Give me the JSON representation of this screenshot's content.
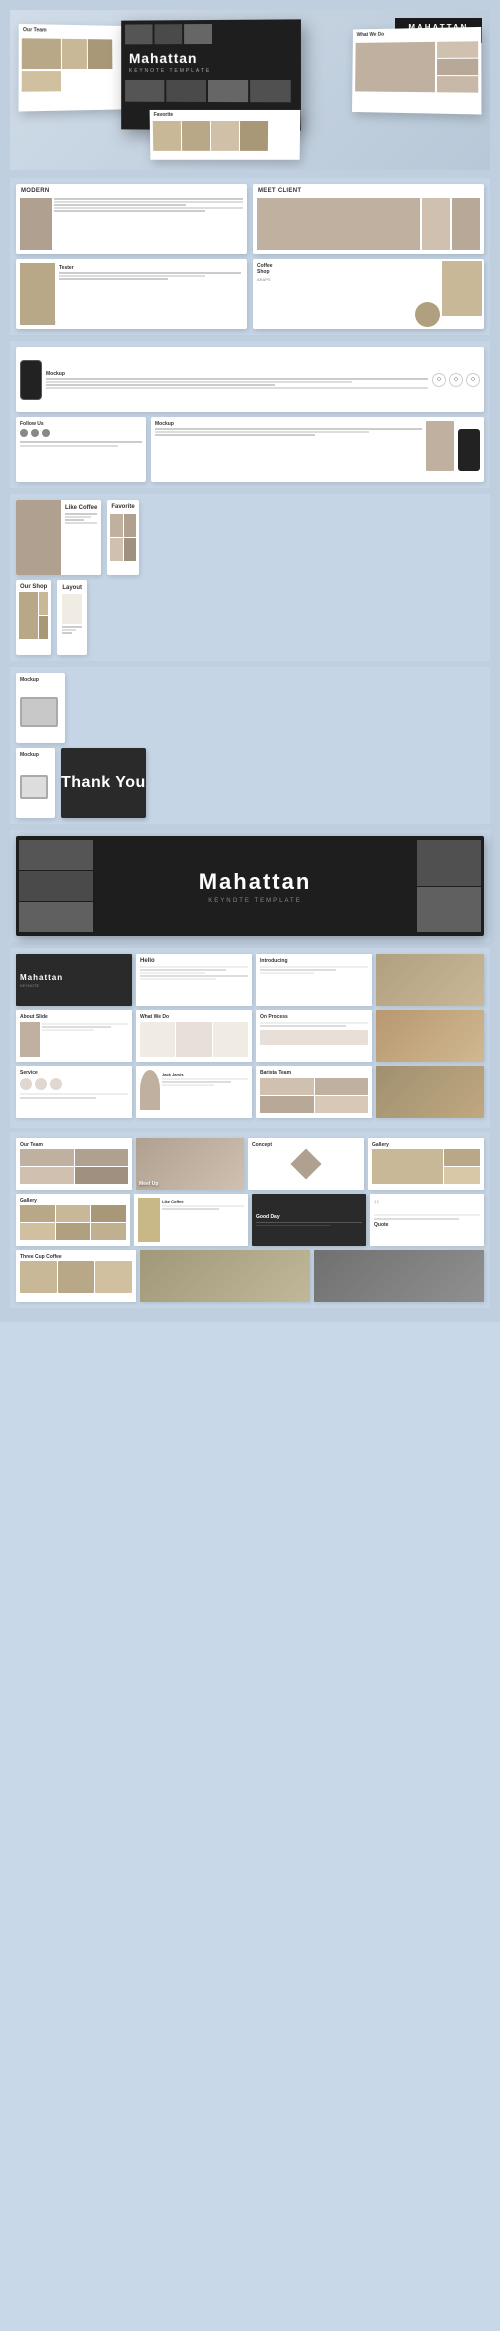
{
  "header": {
    "brand": "MAHATTAN",
    "subtitle": "KEYNOTE TEMPLATE"
  },
  "hero": {
    "slides_3d": [
      "Mahattan",
      "What We Do",
      "Our Team",
      "Favorite"
    ]
  },
  "section1": {
    "slides": [
      {
        "label": "Modern",
        "type": "image-text"
      },
      {
        "label": "Meet Client",
        "type": "image-text"
      },
      {
        "label": "Tester",
        "type": "image-text"
      },
      {
        "label": "Coffee Shop",
        "type": "image-text"
      }
    ]
  },
  "section2": {
    "slides": [
      {
        "label": "Mockup",
        "type": "phone"
      },
      {
        "label": "Follow Us",
        "type": "social"
      },
      {
        "label": "Mockup",
        "type": "phone2"
      }
    ]
  },
  "section3": {
    "slides": [
      {
        "label": "Like Coffee",
        "type": "image-grid"
      },
      {
        "label": "Favorite",
        "type": "image-grid"
      },
      {
        "label": "Our Shop",
        "type": "image-grid"
      },
      {
        "label": "Layout",
        "type": "text-layout"
      }
    ]
  },
  "section4": {
    "slides": [
      {
        "label": "Mockup",
        "type": "tablet"
      },
      {
        "label": "Mockup",
        "type": "wide"
      },
      {
        "label": "Mockup",
        "type": "tablet2"
      },
      {
        "label": "Thank You",
        "type": "dark-thankyou"
      }
    ]
  },
  "section5": {
    "label": "Mahattan",
    "type": "dark-full"
  },
  "section6": {
    "rows": [
      [
        {
          "label": "Mahattan",
          "dark": true
        },
        {
          "label": "Hello",
          "dark": false
        },
        {
          "label": "Introducing",
          "dark": false
        },
        {
          "label": "",
          "dark": false,
          "image": true
        }
      ],
      [
        {
          "label": "About Slide",
          "dark": false
        },
        {
          "label": "What We Do",
          "dark": false
        },
        {
          "label": "On Process",
          "dark": false
        },
        {
          "label": "",
          "dark": false,
          "image": true
        }
      ],
      [
        {
          "label": "Service",
          "dark": false
        },
        {
          "label": "Jack Jarvis",
          "dark": false
        },
        {
          "label": "Barista Team",
          "dark": false
        },
        {
          "label": "",
          "dark": false,
          "image": true
        }
      ]
    ]
  },
  "section7": {
    "rows": [
      [
        {
          "label": "Our Team",
          "dark": false
        },
        {
          "label": "Meet Up",
          "dark": false
        },
        {
          "label": "Concept",
          "dark": false
        },
        {
          "label": "Gallery",
          "dark": false
        }
      ],
      [
        {
          "label": "Gallery",
          "dark": false
        },
        {
          "label": "Like Coffee",
          "dark": false
        },
        {
          "label": "Good Day",
          "dark": false
        },
        {
          "label": "Quote",
          "dark": false
        }
      ],
      [
        {
          "label": "Three Cup Coffee",
          "dark": false
        },
        {
          "label": "",
          "dark": false
        },
        {
          "label": "",
          "dark": false
        },
        {
          "label": "",
          "dark": false
        }
      ]
    ]
  }
}
